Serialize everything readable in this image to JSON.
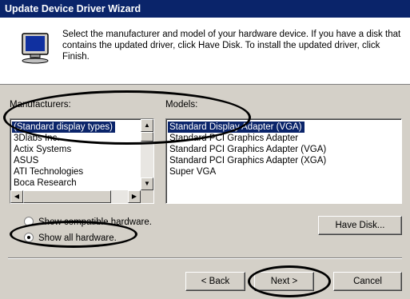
{
  "window": {
    "title": "Update Device Driver Wizard"
  },
  "header": {
    "icon": "monitor-icon",
    "text": "Select the manufacturer and model of your hardware device. If you have a disk that contains the updated driver, click Have Disk. To install the updated driver, click Finish."
  },
  "manufacturers": {
    "label": "Manufacturers:",
    "items": [
      "(Standard display types)",
      "3Dlabs Inc.",
      "Actix Systems",
      "ASUS",
      "ATI Technologies",
      "Boca Research"
    ],
    "selected_index": 0
  },
  "models": {
    "label": "Models:",
    "items": [
      "Standard Display Adapter (VGA)",
      "Standard PCI Graphics Adapter",
      "Standard PCI Graphics Adapter (VGA)",
      "Standard PCI Graphics Adapter (XGA)",
      "Super VGA"
    ],
    "selected_index": 0
  },
  "options": {
    "compatible_label": "Show compatible hardware.",
    "all_label": "Show all hardware.",
    "selected": "all"
  },
  "buttons": {
    "have_disk": "Have Disk...",
    "back": "< Back",
    "next": "Next >",
    "cancel": "Cancel"
  }
}
